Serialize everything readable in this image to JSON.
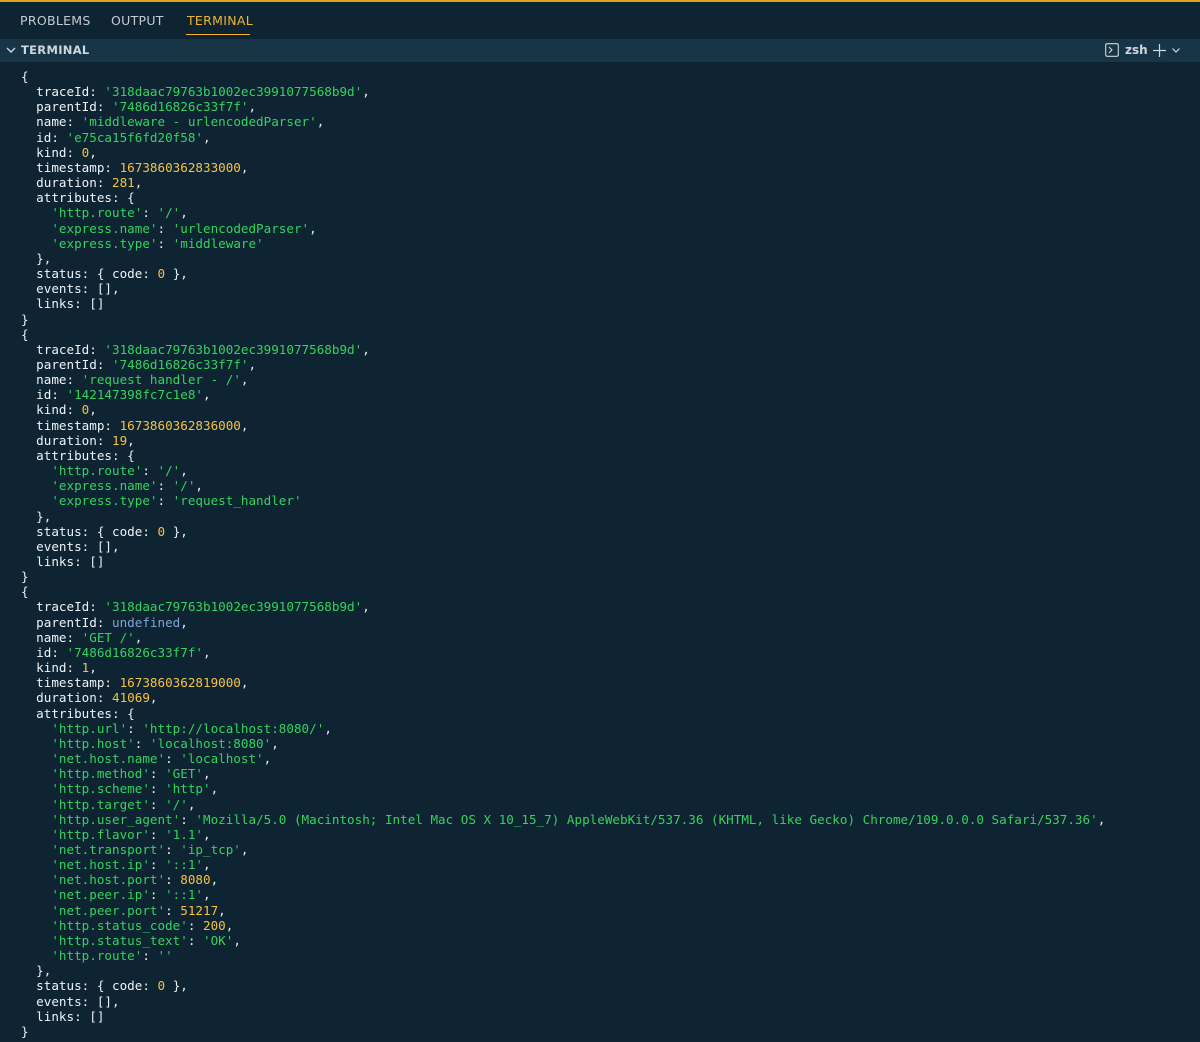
{
  "panel": {
    "tabs": [
      {
        "label": "PROBLEMS",
        "active": false
      },
      {
        "label": "OUTPUT",
        "active": false
      },
      {
        "label": "TERMINAL",
        "active": true
      }
    ],
    "section_title": "TERMINAL",
    "shell_name": "zsh",
    "colors": {
      "background": "#0e2433",
      "header_background": "#183447",
      "active_tab": "#f2b233",
      "string": "#34d35c",
      "number": "#f5c242",
      "undefined": "#7ea6d6"
    },
    "icons": [
      "chevron-down-icon",
      "terminal-icon",
      "plus-icon",
      "dropdown-chevron-icon"
    ]
  },
  "terminal": {
    "lines": [
      [
        [
          "p",
          "{"
        ]
      ],
      [
        [
          "k",
          "  traceId"
        ],
        [
          "p",
          ": "
        ],
        [
          "s",
          "'318daac79763b1002ec3991077568b9d'"
        ],
        [
          "p",
          ","
        ]
      ],
      [
        [
          "k",
          "  parentId"
        ],
        [
          "p",
          ": "
        ],
        [
          "s",
          "'7486d16826c33f7f'"
        ],
        [
          "p",
          ","
        ]
      ],
      [
        [
          "k",
          "  name"
        ],
        [
          "p",
          ": "
        ],
        [
          "s",
          "'middleware - urlencodedParser'"
        ],
        [
          "p",
          ","
        ]
      ],
      [
        [
          "k",
          "  id"
        ],
        [
          "p",
          ": "
        ],
        [
          "s",
          "'e75ca15f6fd20f58'"
        ],
        [
          "p",
          ","
        ]
      ],
      [
        [
          "k",
          "  kind"
        ],
        [
          "p",
          ": "
        ],
        [
          "n",
          "0"
        ],
        [
          "p",
          ","
        ]
      ],
      [
        [
          "k",
          "  timestamp"
        ],
        [
          "p",
          ": "
        ],
        [
          "n",
          "1673860362833000"
        ],
        [
          "p",
          ","
        ]
      ],
      [
        [
          "k",
          "  duration"
        ],
        [
          "p",
          ": "
        ],
        [
          "n",
          "281"
        ],
        [
          "p",
          ","
        ]
      ],
      [
        [
          "k",
          "  attributes"
        ],
        [
          "p",
          ": {"
        ]
      ],
      [
        [
          "s",
          "    'http.route'"
        ],
        [
          "p",
          ": "
        ],
        [
          "s",
          "'/'"
        ],
        [
          "p",
          ","
        ]
      ],
      [
        [
          "s",
          "    'express.name'"
        ],
        [
          "p",
          ": "
        ],
        [
          "s",
          "'urlencodedParser'"
        ],
        [
          "p",
          ","
        ]
      ],
      [
        [
          "s",
          "    'express.type'"
        ],
        [
          "p",
          ": "
        ],
        [
          "s",
          "'middleware'"
        ]
      ],
      [
        [
          "p",
          "  },"
        ]
      ],
      [
        [
          "k",
          "  status"
        ],
        [
          "p",
          ": { "
        ],
        [
          "k",
          "code"
        ],
        [
          "p",
          ": "
        ],
        [
          "n",
          "0"
        ],
        [
          "p",
          " },"
        ]
      ],
      [
        [
          "k",
          "  events"
        ],
        [
          "p",
          ": [],"
        ]
      ],
      [
        [
          "k",
          "  links"
        ],
        [
          "p",
          ": []"
        ]
      ],
      [
        [
          "p",
          "}"
        ]
      ],
      [
        [
          "p",
          "{"
        ]
      ],
      [
        [
          "k",
          "  traceId"
        ],
        [
          "p",
          ": "
        ],
        [
          "s",
          "'318daac79763b1002ec3991077568b9d'"
        ],
        [
          "p",
          ","
        ]
      ],
      [
        [
          "k",
          "  parentId"
        ],
        [
          "p",
          ": "
        ],
        [
          "s",
          "'7486d16826c33f7f'"
        ],
        [
          "p",
          ","
        ]
      ],
      [
        [
          "k",
          "  name"
        ],
        [
          "p",
          ": "
        ],
        [
          "s",
          "'request handler - /'"
        ],
        [
          "p",
          ","
        ]
      ],
      [
        [
          "k",
          "  id"
        ],
        [
          "p",
          ": "
        ],
        [
          "s",
          "'142147398fc7c1e8'"
        ],
        [
          "p",
          ","
        ]
      ],
      [
        [
          "k",
          "  kind"
        ],
        [
          "p",
          ": "
        ],
        [
          "n",
          "0"
        ],
        [
          "p",
          ","
        ]
      ],
      [
        [
          "k",
          "  timestamp"
        ],
        [
          "p",
          ": "
        ],
        [
          "n",
          "1673860362836000"
        ],
        [
          "p",
          ","
        ]
      ],
      [
        [
          "k",
          "  duration"
        ],
        [
          "p",
          ": "
        ],
        [
          "n",
          "19"
        ],
        [
          "p",
          ","
        ]
      ],
      [
        [
          "k",
          "  attributes"
        ],
        [
          "p",
          ": {"
        ]
      ],
      [
        [
          "s",
          "    'http.route'"
        ],
        [
          "p",
          ": "
        ],
        [
          "s",
          "'/'"
        ],
        [
          "p",
          ","
        ]
      ],
      [
        [
          "s",
          "    'express.name'"
        ],
        [
          "p",
          ": "
        ],
        [
          "s",
          "'/'"
        ],
        [
          "p",
          ","
        ]
      ],
      [
        [
          "s",
          "    'express.type'"
        ],
        [
          "p",
          ": "
        ],
        [
          "s",
          "'request_handler'"
        ]
      ],
      [
        [
          "p",
          "  },"
        ]
      ],
      [
        [
          "k",
          "  status"
        ],
        [
          "p",
          ": { "
        ],
        [
          "k",
          "code"
        ],
        [
          "p",
          ": "
        ],
        [
          "n",
          "0"
        ],
        [
          "p",
          " },"
        ]
      ],
      [
        [
          "k",
          "  events"
        ],
        [
          "p",
          ": [],"
        ]
      ],
      [
        [
          "k",
          "  links"
        ],
        [
          "p",
          ": []"
        ]
      ],
      [
        [
          "p",
          "}"
        ]
      ],
      [
        [
          "p",
          "{"
        ]
      ],
      [
        [
          "k",
          "  traceId"
        ],
        [
          "p",
          ": "
        ],
        [
          "s",
          "'318daac79763b1002ec3991077568b9d'"
        ],
        [
          "p",
          ","
        ]
      ],
      [
        [
          "k",
          "  parentId"
        ],
        [
          "p",
          ": "
        ],
        [
          "u",
          "undefined"
        ],
        [
          "p",
          ","
        ]
      ],
      [
        [
          "k",
          "  name"
        ],
        [
          "p",
          ": "
        ],
        [
          "s",
          "'GET /'"
        ],
        [
          "p",
          ","
        ]
      ],
      [
        [
          "k",
          "  id"
        ],
        [
          "p",
          ": "
        ],
        [
          "s",
          "'7486d16826c33f7f'"
        ],
        [
          "p",
          ","
        ]
      ],
      [
        [
          "k",
          "  kind"
        ],
        [
          "p",
          ": "
        ],
        [
          "n",
          "1"
        ],
        [
          "p",
          ","
        ]
      ],
      [
        [
          "k",
          "  timestamp"
        ],
        [
          "p",
          ": "
        ],
        [
          "n",
          "1673860362819000"
        ],
        [
          "p",
          ","
        ]
      ],
      [
        [
          "k",
          "  duration"
        ],
        [
          "p",
          ": "
        ],
        [
          "n",
          "41069"
        ],
        [
          "p",
          ","
        ]
      ],
      [
        [
          "k",
          "  attributes"
        ],
        [
          "p",
          ": {"
        ]
      ],
      [
        [
          "s",
          "    'http.url'"
        ],
        [
          "p",
          ": "
        ],
        [
          "s",
          "'http://localhost:8080/'"
        ],
        [
          "p",
          ","
        ]
      ],
      [
        [
          "s",
          "    'http.host'"
        ],
        [
          "p",
          ": "
        ],
        [
          "s",
          "'localhost:8080'"
        ],
        [
          "p",
          ","
        ]
      ],
      [
        [
          "s",
          "    'net.host.name'"
        ],
        [
          "p",
          ": "
        ],
        [
          "s",
          "'localhost'"
        ],
        [
          "p",
          ","
        ]
      ],
      [
        [
          "s",
          "    'http.method'"
        ],
        [
          "p",
          ": "
        ],
        [
          "s",
          "'GET'"
        ],
        [
          "p",
          ","
        ]
      ],
      [
        [
          "s",
          "    'http.scheme'"
        ],
        [
          "p",
          ": "
        ],
        [
          "s",
          "'http'"
        ],
        [
          "p",
          ","
        ]
      ],
      [
        [
          "s",
          "    'http.target'"
        ],
        [
          "p",
          ": "
        ],
        [
          "s",
          "'/'"
        ],
        [
          "p",
          ","
        ]
      ],
      [
        [
          "s",
          "    'http.user_agent'"
        ],
        [
          "p",
          ": "
        ],
        [
          "s",
          "'Mozilla/5.0 (Macintosh; Intel Mac OS X 10_15_7) AppleWebKit/537.36 (KHTML, like Gecko) Chrome/109.0.0.0 Safari/537.36'"
        ],
        [
          "p",
          ","
        ]
      ],
      [
        [
          "s",
          "    'http.flavor'"
        ],
        [
          "p",
          ": "
        ],
        [
          "s",
          "'1.1'"
        ],
        [
          "p",
          ","
        ]
      ],
      [
        [
          "s",
          "    'net.transport'"
        ],
        [
          "p",
          ": "
        ],
        [
          "s",
          "'ip_tcp'"
        ],
        [
          "p",
          ","
        ]
      ],
      [
        [
          "s",
          "    'net.host.ip'"
        ],
        [
          "p",
          ": "
        ],
        [
          "s",
          "'::1'"
        ],
        [
          "p",
          ","
        ]
      ],
      [
        [
          "s",
          "    'net.host.port'"
        ],
        [
          "p",
          ": "
        ],
        [
          "n",
          "8080"
        ],
        [
          "p",
          ","
        ]
      ],
      [
        [
          "s",
          "    'net.peer.ip'"
        ],
        [
          "p",
          ": "
        ],
        [
          "s",
          "'::1'"
        ],
        [
          "p",
          ","
        ]
      ],
      [
        [
          "s",
          "    'net.peer.port'"
        ],
        [
          "p",
          ": "
        ],
        [
          "n",
          "51217"
        ],
        [
          "p",
          ","
        ]
      ],
      [
        [
          "s",
          "    'http.status_code'"
        ],
        [
          "p",
          ": "
        ],
        [
          "n",
          "200"
        ],
        [
          "p",
          ","
        ]
      ],
      [
        [
          "s",
          "    'http.status_text'"
        ],
        [
          "p",
          ": "
        ],
        [
          "s",
          "'OK'"
        ],
        [
          "p",
          ","
        ]
      ],
      [
        [
          "s",
          "    'http.route'"
        ],
        [
          "p",
          ": "
        ],
        [
          "s",
          "''"
        ]
      ],
      [
        [
          "p",
          "  },"
        ]
      ],
      [
        [
          "k",
          "  status"
        ],
        [
          "p",
          ": { "
        ],
        [
          "k",
          "code"
        ],
        [
          "p",
          ": "
        ],
        [
          "n",
          "0"
        ],
        [
          "p",
          " },"
        ]
      ],
      [
        [
          "k",
          "  events"
        ],
        [
          "p",
          ": [],"
        ]
      ],
      [
        [
          "k",
          "  links"
        ],
        [
          "p",
          ": []"
        ]
      ],
      [
        [
          "p",
          "}"
        ]
      ]
    ]
  }
}
